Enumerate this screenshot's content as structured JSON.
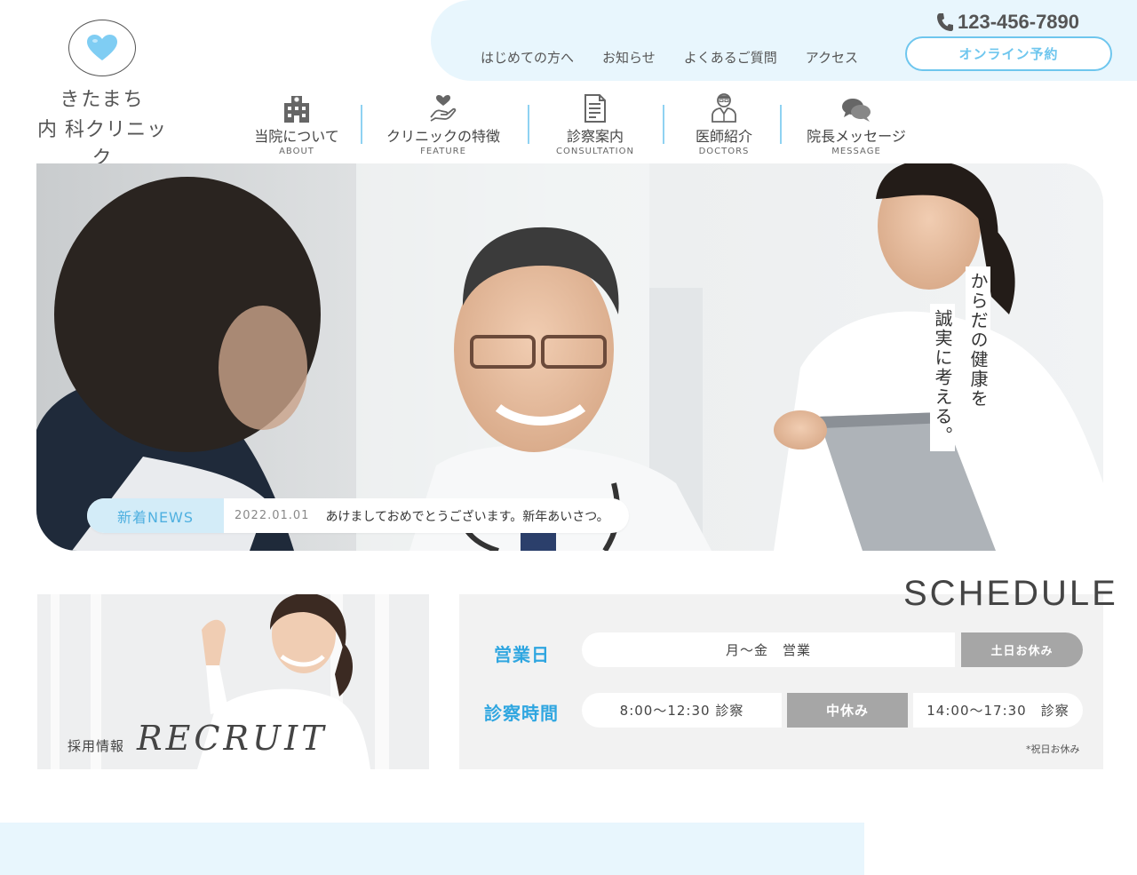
{
  "brand": {
    "name_line1": "きたまち",
    "name_line2": "内 科クリニック",
    "accent_color": "#6ec6ee",
    "heart_color": "#7fcdf3"
  },
  "header": {
    "phone": "123-456-7890",
    "reserve_label": "オンライン予約",
    "subnav": [
      {
        "label": "はじめての方へ"
      },
      {
        "label": "お知らせ"
      },
      {
        "label": "よくあるご質問"
      },
      {
        "label": "アクセス"
      }
    ],
    "mainnav": [
      {
        "label": "当院について",
        "en": "ABOUT",
        "icon": "hospital-icon"
      },
      {
        "label": "クリニックの特徴",
        "en": "FEATURE",
        "icon": "hand-heart-icon"
      },
      {
        "label": "診察案内",
        "en": "CONSULTATION",
        "icon": "document-icon"
      },
      {
        "label": "医師紹介",
        "en": "DOCTORS",
        "icon": "doctor-icon"
      },
      {
        "label": "院長メッセージ",
        "en": "MESSAGE",
        "icon": "chat-bubbles-icon"
      }
    ]
  },
  "hero": {
    "tagline_col1": "からだの健康を",
    "tagline_col2": "誠実に考える。"
  },
  "news": {
    "label": "新着NEWS",
    "date": "2022.01.01",
    "text": "あけましておめでとうございます。新年あいさつ。"
  },
  "recruit": {
    "label_jp": "採用情報",
    "label_en": "RECRUIT"
  },
  "schedule": {
    "title": "SCHEDULE",
    "days_label": "営業日",
    "days_open": "月～金　営業",
    "days_closed": "土日お休み",
    "hours_label": "診察時間",
    "hours_morning": "8:00～12:30 診察",
    "hours_break": "中休み",
    "hours_afternoon": "14:00～17:30　診察",
    "note": "*祝日お休み"
  }
}
